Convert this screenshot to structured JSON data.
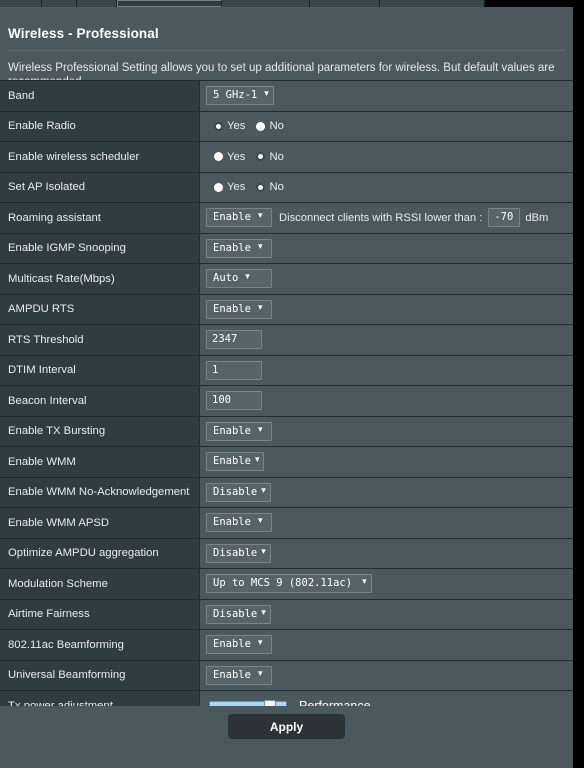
{
  "window": {
    "tabs": [
      "",
      "",
      "",
      "",
      "",
      "",
      "",
      ""
    ]
  },
  "header": {
    "title": "Wireless - Professional",
    "description": "Wireless Professional Setting allows you to set up additional parameters for wireless. But default values are recommended."
  },
  "settings": {
    "band": {
      "label": "Band",
      "value": "5 GHz-1",
      "chevron": "⌄"
    },
    "enable_radio": {
      "label": "Enable Radio",
      "yes": "Yes",
      "no": "No",
      "selected": "Yes"
    },
    "wireless_scheduler": {
      "label": "Enable wireless scheduler",
      "yes": "Yes",
      "no": "No",
      "selected": "No"
    },
    "ap_isolated": {
      "label": "Set AP Isolated",
      "yes": "Yes",
      "no": "No",
      "selected": "No"
    },
    "roaming_assistant": {
      "label": "Roaming assistant",
      "value": "Enable",
      "inline_label": "Disconnect clients with RSSI lower than :",
      "rssi_value": "-70",
      "unit": "dBm"
    },
    "igmp_snooping": {
      "label": "Enable IGMP Snooping",
      "value": "Enable"
    },
    "multicast_rate": {
      "label": "Multicast Rate(Mbps)",
      "value": "Auto"
    },
    "ampdu_rts": {
      "label": "AMPDU RTS",
      "value": "Enable"
    },
    "rts_threshold": {
      "label": "RTS Threshold",
      "value": "2347"
    },
    "dtim_interval": {
      "label": "DTIM Interval",
      "value": "1"
    },
    "beacon_interval": {
      "label": "Beacon Interval",
      "value": "100"
    },
    "tx_bursting": {
      "label": "Enable TX Bursting",
      "value": "Enable"
    },
    "wmm": {
      "label": "Enable WMM",
      "value": "Enable"
    },
    "wmm_no_ack": {
      "label": "Enable WMM No-Acknowledgement",
      "value": "Disable"
    },
    "wmm_apsd": {
      "label": "Enable WMM APSD",
      "value": "Enable"
    },
    "optimize_ampdu": {
      "label": "Optimize AMPDU aggregation",
      "value": "Disable"
    },
    "modulation_scheme": {
      "label": "Modulation Scheme",
      "value": "Up to MCS 9 (802.11ac)"
    },
    "airtime_fairness": {
      "label": "Airtime Fairness",
      "value": "Disable"
    },
    "beamforming_11ac": {
      "label": "802.11ac Beamforming",
      "value": "Enable"
    },
    "universal_beamforming": {
      "label": "Universal Beamforming",
      "value": "Enable"
    },
    "tx_power": {
      "label": "Tx power adjustment",
      "mode": "Performance",
      "percent": 82
    }
  },
  "footer": {
    "apply_label": "Apply"
  },
  "colors": {
    "panel": "#4b585d",
    "label_column": "#2f3c42",
    "border": "#232c30",
    "control_bg": "#56646a",
    "control_border": "#76858b",
    "slider_fill": "#a9dcf2",
    "apply_bg": "#2b3337",
    "text": "#e9ecee"
  }
}
